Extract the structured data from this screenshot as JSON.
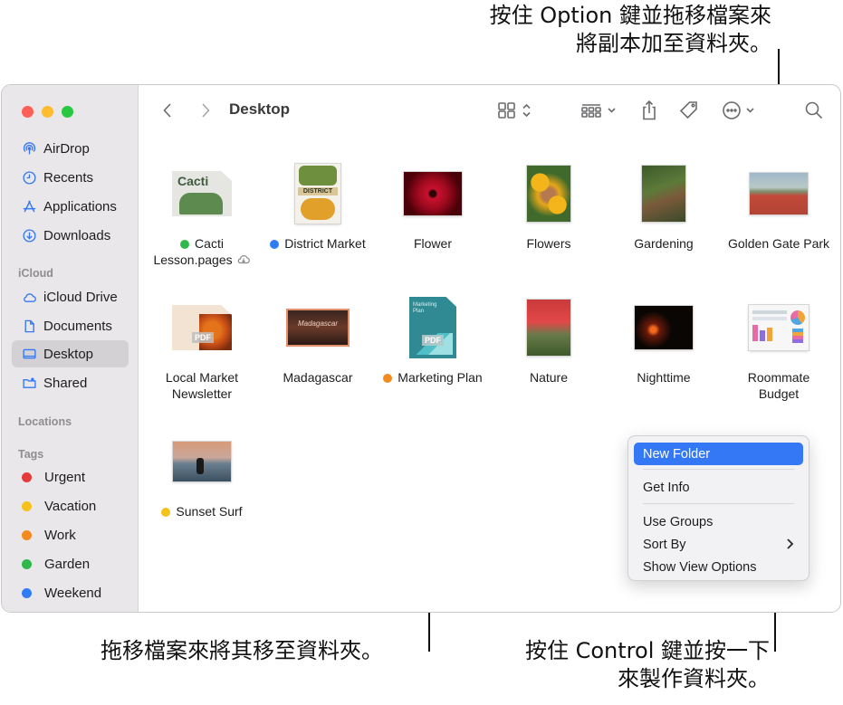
{
  "callouts": {
    "top_right": [
      "按住 Option 鍵並拖移檔案來",
      "將副本加至資料夾。"
    ],
    "bottom_left": [
      "拖移檔案來將其移至資料夾。"
    ],
    "bottom_right": [
      "按住 Control 鍵並按一下",
      "來製作資料夾。"
    ]
  },
  "window": {
    "title": "Desktop"
  },
  "sidebar": {
    "favorites": [
      {
        "label": "AirDrop",
        "icon": "airdrop-icon"
      },
      {
        "label": "Recents",
        "icon": "clock-icon"
      },
      {
        "label": "Applications",
        "icon": "applications-icon"
      },
      {
        "label": "Downloads",
        "icon": "download-icon"
      }
    ],
    "icloud_header": "iCloud",
    "icloud": [
      {
        "label": "iCloud Drive",
        "icon": "cloud-icon"
      },
      {
        "label": "Documents",
        "icon": "document-icon"
      },
      {
        "label": "Desktop",
        "icon": "desktop-icon",
        "selected": true
      },
      {
        "label": "Shared",
        "icon": "shared-folder-icon"
      }
    ],
    "locations_header": "Locations",
    "tags_header": "Tags",
    "tags": [
      {
        "label": "Urgent",
        "color": "#e63a3a"
      },
      {
        "label": "Vacation",
        "color": "#f4c21a"
      },
      {
        "label": "Work",
        "color": "#f38a1d"
      },
      {
        "label": "Garden",
        "color": "#30b94a"
      },
      {
        "label": "Weekend",
        "color": "#2f7cf6"
      }
    ]
  },
  "files": [
    {
      "name": "Cacti Lesson.pages",
      "lines": [
        "Cacti",
        "Lesson.pages"
      ],
      "tag_color": "#30b94a",
      "cloud": true
    },
    {
      "name": "District Market",
      "tag_color": "#2f7cf6"
    },
    {
      "name": "Flower"
    },
    {
      "name": "Flowers"
    },
    {
      "name": "Gardening"
    },
    {
      "name": "Golden Gate Park"
    },
    {
      "name": "Local Market Newsletter",
      "lines": [
        "Local Market",
        "Newsletter"
      ]
    },
    {
      "name": "Madagascar"
    },
    {
      "name": "Marketing Plan",
      "tag_color": "#f38a1d"
    },
    {
      "name": "Nature"
    },
    {
      "name": "Nighttime"
    },
    {
      "name": "Roommate Budget",
      "lines": [
        "Roommate",
        "Budget"
      ]
    },
    {
      "name": "Sunset Surf",
      "tag_color": "#f4c21a"
    }
  ],
  "thumb_text": {
    "cacti": "Cacti",
    "district": "DISTRICT",
    "pdf": "PDF",
    "marketing": "Marketing Plan",
    "madagascar": "Madagascar"
  },
  "context_menu": {
    "items": [
      "New Folder",
      "Get Info",
      "Use Groups",
      "Sort By",
      "Show View Options"
    ],
    "highlighted": "New Folder"
  },
  "colors": {
    "accent": "#3478f6",
    "sidebar_icon": "#3478f6"
  }
}
